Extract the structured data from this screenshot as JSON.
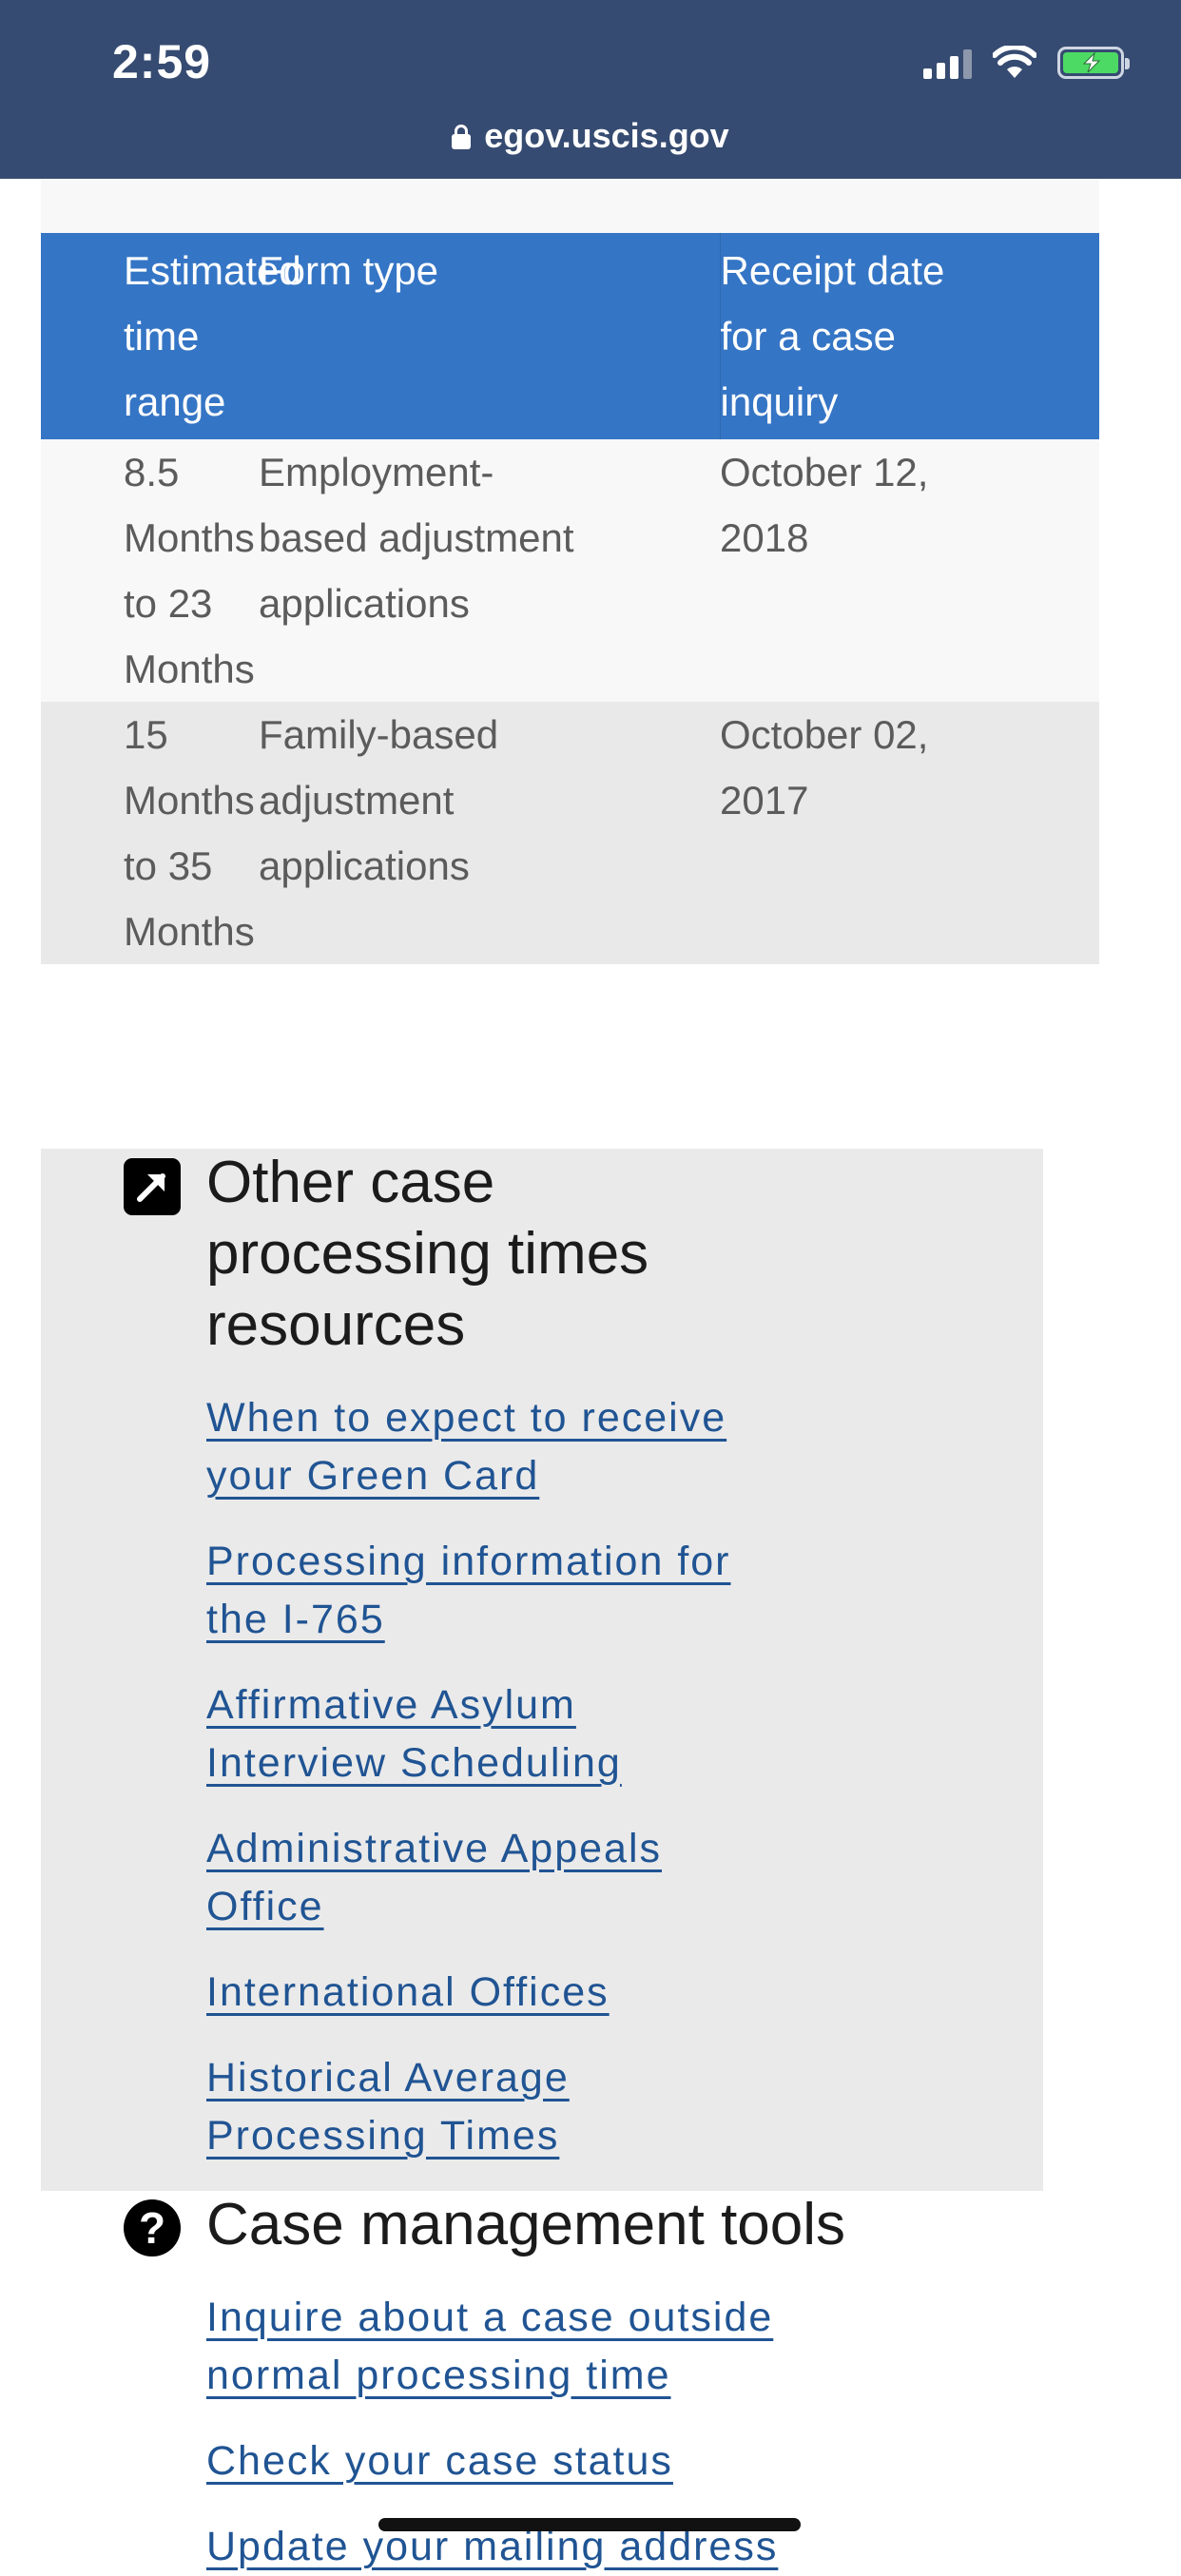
{
  "status_bar": {
    "time": "2:59",
    "address": "egov.uscis.gov",
    "icons": [
      "signal-icon",
      "wifi-icon",
      "battery-charging-icon",
      "lock-icon"
    ],
    "battery_color": "#4cd964"
  },
  "colors": {
    "topbar": "#364b71",
    "table_header": "#3575c5",
    "link": "#205493",
    "resources_bg": "#eaeaea"
  },
  "table": {
    "headers": [
      "Estimated time range",
      "Form type",
      "Receipt date for a case inquiry"
    ],
    "header_lines": [
      [
        "Estimated",
        "time",
        "range"
      ],
      [
        "Form type"
      ],
      [
        "Receipt date",
        "for a case",
        "inquiry"
      ]
    ],
    "rows": [
      {
        "range": "8.5 Months to 23 Months",
        "range_lines": [
          "8.5",
          "Months",
          "to 23",
          "Months"
        ],
        "form_type_lines": [
          "Employment-",
          "based adjustment",
          "applications"
        ],
        "receipt_lines": [
          "October 12,",
          "2018"
        ]
      },
      {
        "range": "15 Months to 35 Months",
        "range_lines": [
          "15",
          "Months",
          "to 35",
          "Months"
        ],
        "form_type_lines": [
          "Family-based",
          "adjustment",
          "applications"
        ],
        "receipt_lines": [
          "October 02,",
          "2017"
        ]
      }
    ]
  },
  "resources": {
    "icon": "external-link-icon",
    "title_lines": [
      "Other case",
      "processing times",
      "resources"
    ],
    "links": [
      {
        "lines": [
          "When to expect to receive",
          "your Green Card"
        ]
      },
      {
        "lines": [
          "Processing information for",
          "the I-765"
        ]
      },
      {
        "lines": [
          "Affirmative Asylum",
          "Interview Scheduling"
        ]
      },
      {
        "lines": [
          "Administrative Appeals",
          "Office"
        ]
      },
      {
        "lines": [
          "International Offices"
        ]
      },
      {
        "lines": [
          "Historical Average",
          "Processing Times"
        ]
      }
    ]
  },
  "case_tools": {
    "icon": "question-circle-icon",
    "title": "Case management tools",
    "links": [
      {
        "lines": [
          "Inquire about a case outside",
          "normal processing time"
        ]
      },
      {
        "lines": [
          "Check your case status"
        ]
      },
      {
        "lines": [
          "Update your mailing address"
        ]
      }
    ]
  }
}
